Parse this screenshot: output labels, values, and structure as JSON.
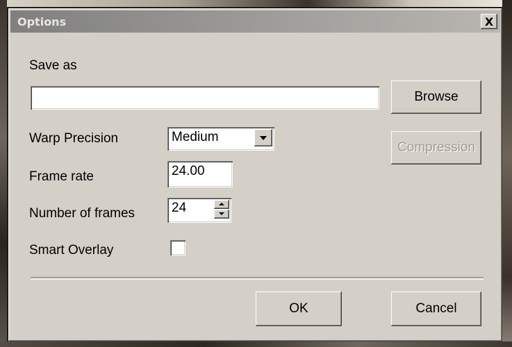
{
  "dialog": {
    "title": "Options",
    "close_glyph": "X",
    "save_as": {
      "label": "Save as",
      "value": ""
    },
    "browse_label": "Browse",
    "warp_precision": {
      "label": "Warp Precision",
      "selected": "Medium"
    },
    "compression_label": "Compression",
    "frame_rate": {
      "label": "Frame rate",
      "value": "24.00"
    },
    "number_of_frames": {
      "label": "Number of frames",
      "value": "24"
    },
    "smart_overlay": {
      "label": "Smart Overlay",
      "checked": false
    },
    "ok_label": "OK",
    "cancel_label": "Cancel"
  },
  "icons": {
    "close": "close-icon",
    "dropdown": "chevron-down-icon",
    "spin_up": "spin-up-icon",
    "spin_down": "spin-down-icon"
  },
  "colors": {
    "window_face": "#d4d0c8",
    "title_gradient_start": "#808080",
    "title_gradient_end": "#b9b6b0",
    "disabled_text": "#a09d97"
  }
}
